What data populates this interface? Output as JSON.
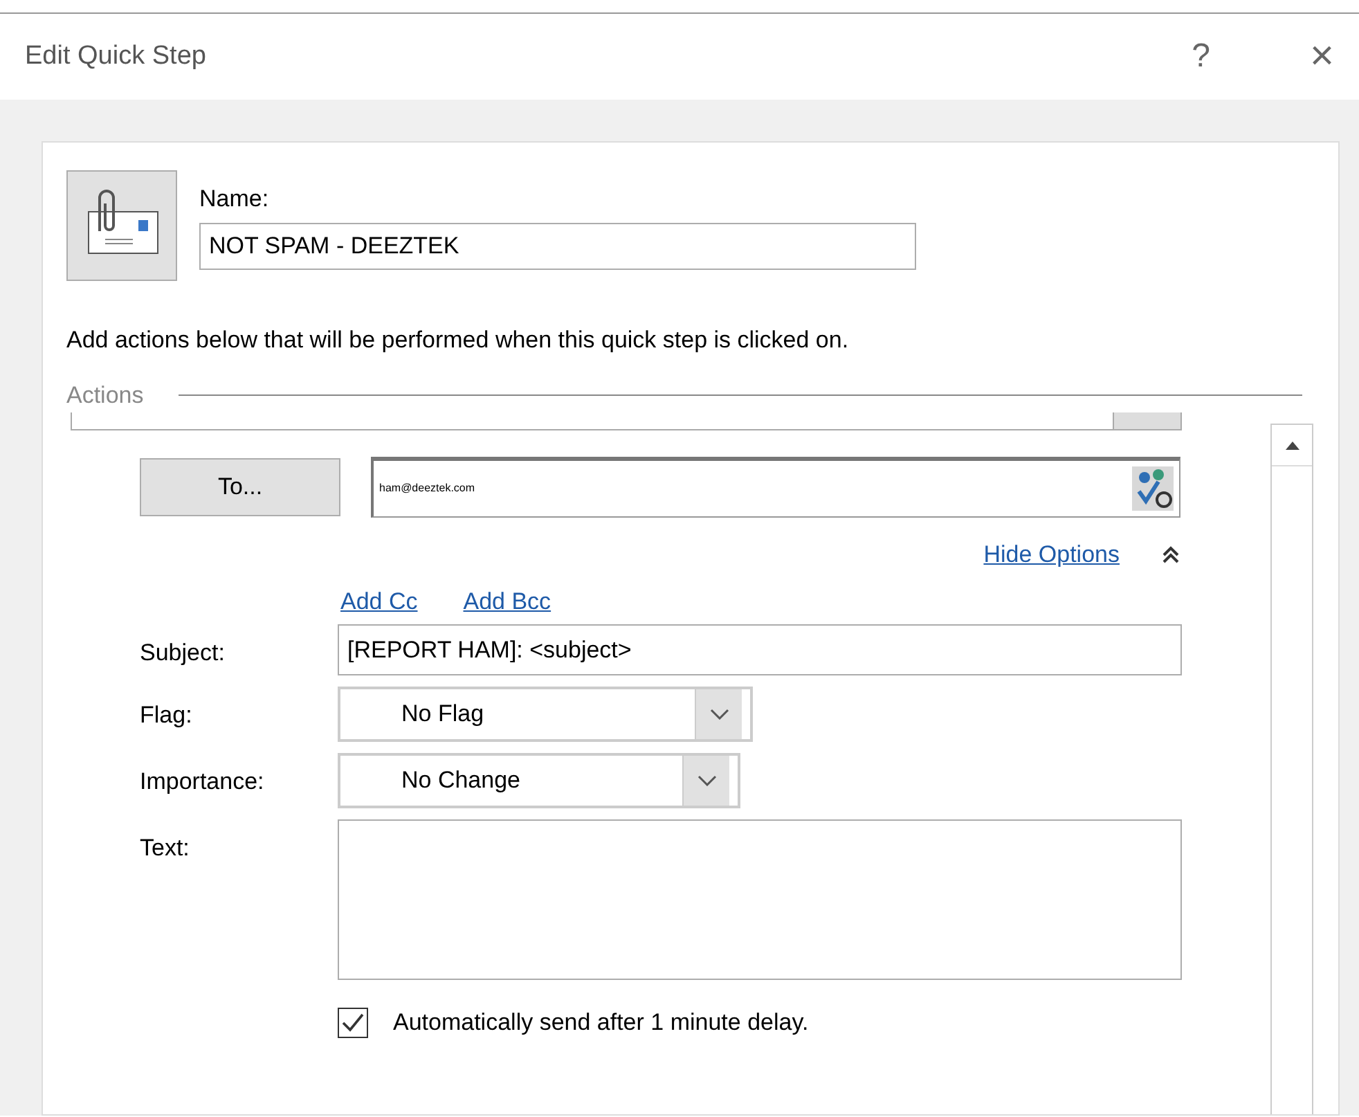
{
  "window": {
    "title": "Edit Quick Step",
    "help": "?",
    "close": "×"
  },
  "name": {
    "label": "Name:",
    "value": "NOT SPAM - DEEZTEK"
  },
  "instruction": "Add actions below that will be performed when this quick step is clicked on.",
  "actions": {
    "legend": "Actions",
    "to": {
      "button": "To...",
      "value": "ham@deeztek.com"
    },
    "hide_options": "Hide Options",
    "add_cc": "Add Cc",
    "add_bcc": "Add Bcc",
    "fields": [
      {
        "kind": "text",
        "label": "Subject:",
        "value": "[REPORT HAM]: <subject>"
      },
      {
        "kind": "select",
        "label": "Flag:",
        "value": "No Flag"
      },
      {
        "kind": "select",
        "label": "Importance:",
        "value": "No Change"
      },
      {
        "kind": "textarea",
        "label": "Text:"
      }
    ],
    "auto_send": {
      "label": "Automatically send after 1 minute delay.",
      "checked": true
    }
  }
}
